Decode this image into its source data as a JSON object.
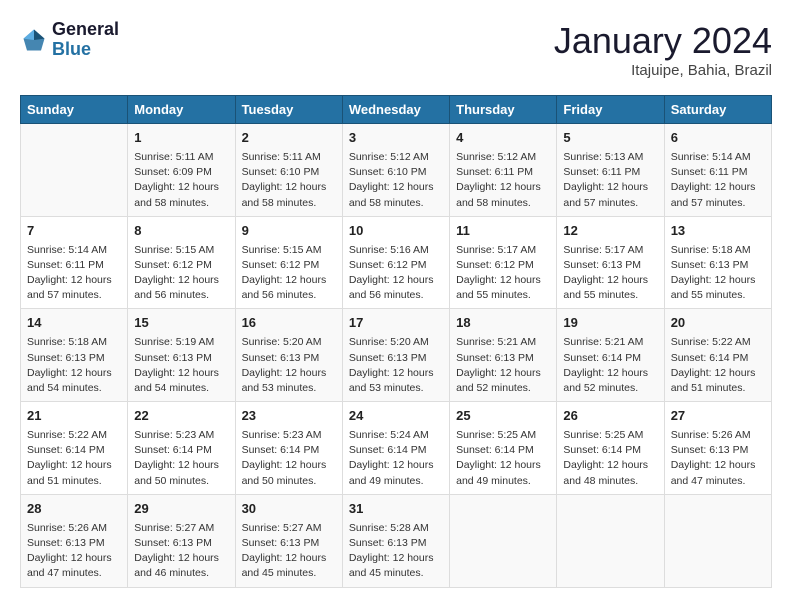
{
  "header": {
    "logo_line1": "General",
    "logo_line2": "Blue",
    "title": "January 2024",
    "subtitle": "Itajuipe, Bahia, Brazil"
  },
  "columns": [
    "Sunday",
    "Monday",
    "Tuesday",
    "Wednesday",
    "Thursday",
    "Friday",
    "Saturday"
  ],
  "weeks": [
    [
      {
        "day": "",
        "text": ""
      },
      {
        "day": "1",
        "text": "Sunrise: 5:11 AM\nSunset: 6:09 PM\nDaylight: 12 hours\nand 58 minutes."
      },
      {
        "day": "2",
        "text": "Sunrise: 5:11 AM\nSunset: 6:10 PM\nDaylight: 12 hours\nand 58 minutes."
      },
      {
        "day": "3",
        "text": "Sunrise: 5:12 AM\nSunset: 6:10 PM\nDaylight: 12 hours\nand 58 minutes."
      },
      {
        "day": "4",
        "text": "Sunrise: 5:12 AM\nSunset: 6:11 PM\nDaylight: 12 hours\nand 58 minutes."
      },
      {
        "day": "5",
        "text": "Sunrise: 5:13 AM\nSunset: 6:11 PM\nDaylight: 12 hours\nand 57 minutes."
      },
      {
        "day": "6",
        "text": "Sunrise: 5:14 AM\nSunset: 6:11 PM\nDaylight: 12 hours\nand 57 minutes."
      }
    ],
    [
      {
        "day": "7",
        "text": "Sunrise: 5:14 AM\nSunset: 6:11 PM\nDaylight: 12 hours\nand 57 minutes."
      },
      {
        "day": "8",
        "text": "Sunrise: 5:15 AM\nSunset: 6:12 PM\nDaylight: 12 hours\nand 56 minutes."
      },
      {
        "day": "9",
        "text": "Sunrise: 5:15 AM\nSunset: 6:12 PM\nDaylight: 12 hours\nand 56 minutes."
      },
      {
        "day": "10",
        "text": "Sunrise: 5:16 AM\nSunset: 6:12 PM\nDaylight: 12 hours\nand 56 minutes."
      },
      {
        "day": "11",
        "text": "Sunrise: 5:17 AM\nSunset: 6:12 PM\nDaylight: 12 hours\nand 55 minutes."
      },
      {
        "day": "12",
        "text": "Sunrise: 5:17 AM\nSunset: 6:13 PM\nDaylight: 12 hours\nand 55 minutes."
      },
      {
        "day": "13",
        "text": "Sunrise: 5:18 AM\nSunset: 6:13 PM\nDaylight: 12 hours\nand 55 minutes."
      }
    ],
    [
      {
        "day": "14",
        "text": "Sunrise: 5:18 AM\nSunset: 6:13 PM\nDaylight: 12 hours\nand 54 minutes."
      },
      {
        "day": "15",
        "text": "Sunrise: 5:19 AM\nSunset: 6:13 PM\nDaylight: 12 hours\nand 54 minutes."
      },
      {
        "day": "16",
        "text": "Sunrise: 5:20 AM\nSunset: 6:13 PM\nDaylight: 12 hours\nand 53 minutes."
      },
      {
        "day": "17",
        "text": "Sunrise: 5:20 AM\nSunset: 6:13 PM\nDaylight: 12 hours\nand 53 minutes."
      },
      {
        "day": "18",
        "text": "Sunrise: 5:21 AM\nSunset: 6:13 PM\nDaylight: 12 hours\nand 52 minutes."
      },
      {
        "day": "19",
        "text": "Sunrise: 5:21 AM\nSunset: 6:14 PM\nDaylight: 12 hours\nand 52 minutes."
      },
      {
        "day": "20",
        "text": "Sunrise: 5:22 AM\nSunset: 6:14 PM\nDaylight: 12 hours\nand 51 minutes."
      }
    ],
    [
      {
        "day": "21",
        "text": "Sunrise: 5:22 AM\nSunset: 6:14 PM\nDaylight: 12 hours\nand 51 minutes."
      },
      {
        "day": "22",
        "text": "Sunrise: 5:23 AM\nSunset: 6:14 PM\nDaylight: 12 hours\nand 50 minutes."
      },
      {
        "day": "23",
        "text": "Sunrise: 5:23 AM\nSunset: 6:14 PM\nDaylight: 12 hours\nand 50 minutes."
      },
      {
        "day": "24",
        "text": "Sunrise: 5:24 AM\nSunset: 6:14 PM\nDaylight: 12 hours\nand 49 minutes."
      },
      {
        "day": "25",
        "text": "Sunrise: 5:25 AM\nSunset: 6:14 PM\nDaylight: 12 hours\nand 49 minutes."
      },
      {
        "day": "26",
        "text": "Sunrise: 5:25 AM\nSunset: 6:14 PM\nDaylight: 12 hours\nand 48 minutes."
      },
      {
        "day": "27",
        "text": "Sunrise: 5:26 AM\nSunset: 6:13 PM\nDaylight: 12 hours\nand 47 minutes."
      }
    ],
    [
      {
        "day": "28",
        "text": "Sunrise: 5:26 AM\nSunset: 6:13 PM\nDaylight: 12 hours\nand 47 minutes."
      },
      {
        "day": "29",
        "text": "Sunrise: 5:27 AM\nSunset: 6:13 PM\nDaylight: 12 hours\nand 46 minutes."
      },
      {
        "day": "30",
        "text": "Sunrise: 5:27 AM\nSunset: 6:13 PM\nDaylight: 12 hours\nand 45 minutes."
      },
      {
        "day": "31",
        "text": "Sunrise: 5:28 AM\nSunset: 6:13 PM\nDaylight: 12 hours\nand 45 minutes."
      },
      {
        "day": "",
        "text": ""
      },
      {
        "day": "",
        "text": ""
      },
      {
        "day": "",
        "text": ""
      }
    ]
  ]
}
